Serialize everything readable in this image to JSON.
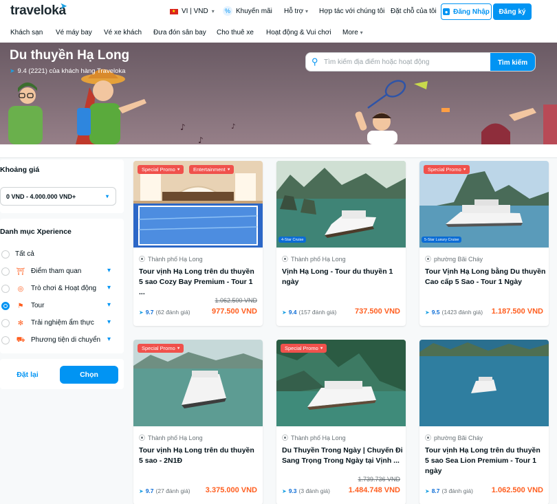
{
  "header": {
    "logo": "traveloka",
    "language": "VI | VND",
    "promo": "Khuyến mãi",
    "support": "Hỗ trợ",
    "partner": "Hợp tác với chúng tôi",
    "bookings": "Đặt chỗ của tôi",
    "login": "Đăng Nhập",
    "register": "Đăng ký"
  },
  "nav": {
    "items": [
      "Khách sạn",
      "Vé máy bay",
      "Vé xe khách",
      "Đưa đón sân bay",
      "Cho thuê xe",
      "Hoạt động & Vui chơi",
      "More"
    ]
  },
  "hero": {
    "title": "Du thuyền Hạ Long",
    "rating": "9.4 (2221) của khách hàng Traveloka",
    "search_placeholder": "Tìm kiếm địa điểm hoặc hoạt động",
    "search_button": "Tìm kiếm"
  },
  "sidebar": {
    "price_title": "Khoảng giá",
    "price_value": "0 VND - 4.000.000 VND+",
    "category_title": "Danh mục Xperience",
    "categories": [
      {
        "label": "Tất cả",
        "icon": "none",
        "selected": false
      },
      {
        "label": "Điểm tham quan",
        "icon": "attraction-icon",
        "selected": false
      },
      {
        "label": "Trò chơi & Hoạt động",
        "icon": "activity-icon",
        "selected": false
      },
      {
        "label": "Tour",
        "icon": "tour-icon",
        "selected": true
      },
      {
        "label": "Trải nghiệm ẩm thực",
        "icon": "food-icon",
        "selected": false
      },
      {
        "label": "Phương tiện di chuyển",
        "icon": "transport-icon",
        "selected": false
      }
    ],
    "reset": "Đặt lại",
    "choose": "Chọn"
  },
  "cards": [
    {
      "badges": [
        "Special Promo",
        "Entertainment"
      ],
      "tag": "",
      "location": "Thành phố Hạ Long",
      "title": "Tour vịnh Hạ Long trên du thuyền 5 sao Cozy Bay Premium - Tour 1 ...",
      "original_price": "1.062.500 VND",
      "score": "9.7",
      "reviews": "(62 đánh giá)",
      "price": "977.500 VND"
    },
    {
      "badges": [],
      "tag": "4-Star Cruise",
      "location": "Thành phố Hạ Long",
      "title": "Vịnh Hạ Long - Tour du thuyền 1 ngày",
      "original_price": "",
      "score": "9.4",
      "reviews": "(157 đánh giá)",
      "price": "737.500 VND"
    },
    {
      "badges": [
        "Special Promo"
      ],
      "tag": "5-Star Luxury Cruise",
      "location": "phường Bãi Cháy",
      "title": "Tour Vịnh Hạ Long bằng Du thuyền Cao cấp 5 Sao - Tour 1 Ngày",
      "original_price": "",
      "score": "9.5",
      "reviews": "(1423 đánh giá)",
      "price": "1.187.500 VND"
    },
    {
      "badges": [
        "Special Promo"
      ],
      "tag": "",
      "location": "Thành phố Hạ Long",
      "title": "Tour vịnh Hạ Long trên du thuyền 5 sao - 2N1Đ",
      "original_price": "",
      "score": "9.7",
      "reviews": "(27 đánh giá)",
      "price": "3.375.000 VND"
    },
    {
      "badges": [
        "Special Promo"
      ],
      "tag": "",
      "location": "Thành phố Hạ Long",
      "title": "Du Thuyền Trong Ngày | Chuyến Đi Sang Trọng Trong Ngày tại Vịnh ...",
      "original_price": "1.739.736 VND",
      "score": "9.3",
      "reviews": "(3 đánh giá)",
      "price": "1.484.748 VND"
    },
    {
      "badges": [],
      "tag": "",
      "location": "phường Bãi Cháy",
      "title": "Tour vịnh Hạ Long trên du thuyền 5 sao Sea Lion Premium - Tour 1 ngày",
      "original_price": "",
      "score": "8.7",
      "reviews": "(3 đánh giá)",
      "price": "1.062.500 VND"
    }
  ],
  "colors": {
    "brand_blue": "#0194f3",
    "price_orange": "#ff5e1f",
    "promo_red": "#f0514c"
  }
}
